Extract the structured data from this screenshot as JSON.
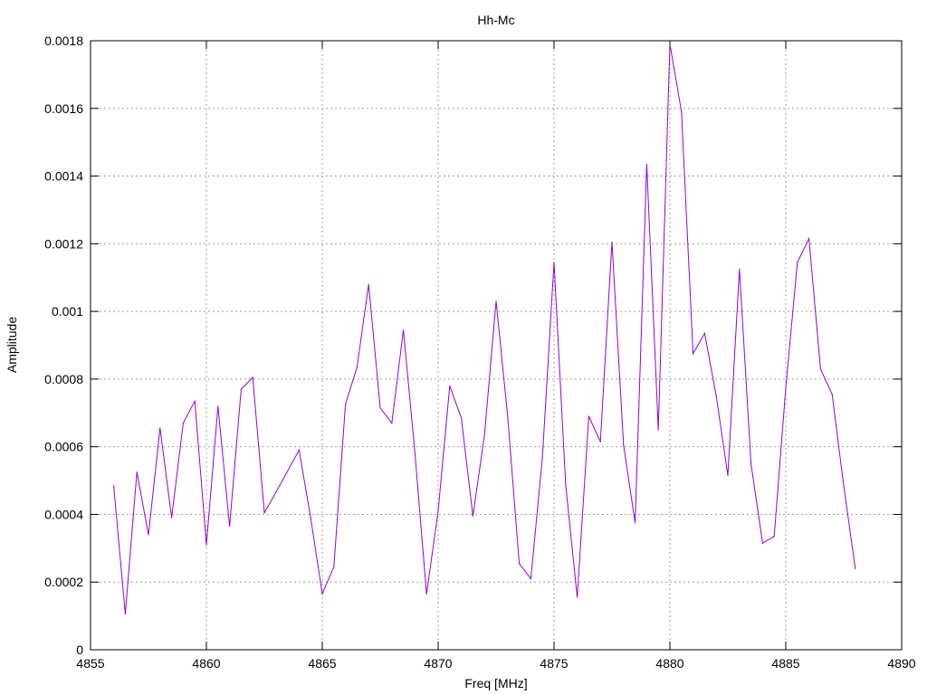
{
  "chart_data": {
    "type": "line",
    "title": "Hh-Mc",
    "xlabel": "Freq [MHz]",
    "ylabel": "Amplitude",
    "xlim": [
      4855,
      4890
    ],
    "ylim": [
      0,
      0.0018
    ],
    "xticks": [
      "4855",
      "4860",
      "4865",
      "4870",
      "4875",
      "4880",
      "4885",
      "4890"
    ],
    "yticks": [
      "0",
      "0.0002",
      "0.0004",
      "0.0006",
      "0.0008",
      "0.001",
      "0.0012",
      "0.0014",
      "0.0016",
      "0.0018"
    ],
    "grid": true,
    "line_color": "#9400d3",
    "series": [
      {
        "x": [
          4856.0,
          4856.5,
          4857.0,
          4857.5,
          4858.0,
          4858.5,
          4859.0,
          4859.5,
          4860.0,
          4860.5,
          4861.0,
          4861.5,
          4862.0,
          4862.5,
          4863.0,
          4864.0,
          4864.5,
          4865.0,
          4865.5,
          4866.0,
          4866.5,
          4867.0,
          4867.5,
          4868.0,
          4868.5,
          4869.0,
          4869.5,
          4870.0,
          4870.5,
          4871.0,
          4871.5,
          4872.0,
          4872.5,
          4873.0,
          4873.5,
          4874.0,
          4874.5,
          4875.0,
          4875.5,
          4876.0,
          4876.5,
          4877.0,
          4877.5,
          4878.0,
          4878.5,
          4879.0,
          4879.5,
          4880.0,
          4880.5,
          4881.0,
          4881.5,
          4882.0,
          4882.5,
          4883.0,
          4883.5,
          4884.0,
          4884.5,
          4885.0,
          4885.5,
          4886.0,
          4886.5,
          4887.0,
          4887.5,
          4888.0
        ],
        "y": [
          0.000485,
          0.000105,
          0.000525,
          0.00034,
          0.000655,
          0.00039,
          0.00067,
          0.000735,
          0.00031,
          0.00072,
          0.000365,
          0.00077,
          0.000805,
          0.000405,
          0.000465,
          0.00059,
          0.00039,
          0.000165,
          0.000245,
          0.000725,
          0.000835,
          0.00108,
          0.000715,
          0.00067,
          0.000945,
          0.00058,
          0.000165,
          0.00041,
          0.00078,
          0.000685,
          0.000395,
          0.000635,
          0.00103,
          0.00069,
          0.000255,
          0.00021,
          0.00057,
          0.001145,
          0.00049,
          0.000155,
          0.00069,
          0.000615,
          0.001205,
          0.000605,
          0.000375,
          0.001435,
          0.00065,
          0.00179,
          0.00159,
          0.000875,
          0.000935,
          0.00075,
          0.000515,
          0.001125,
          0.00055,
          0.000315,
          0.000335,
          0.000775,
          0.001145,
          0.001215,
          0.00083,
          0.000755,
          0.000485,
          0.00024
        ]
      }
    ]
  }
}
